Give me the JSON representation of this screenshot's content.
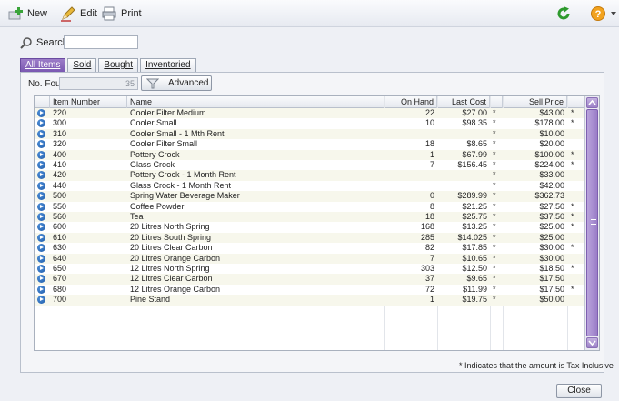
{
  "toolbar": {
    "new_label": "New",
    "edit_label": "Edit",
    "print_label": "Print",
    "icons": [
      "new-icon",
      "edit-icon",
      "print-icon",
      "refresh-icon",
      "help-icon"
    ],
    "accent_color": "#2e9a2e"
  },
  "search": {
    "label": "Search:",
    "value": ""
  },
  "tabs": [
    {
      "label": "All Items",
      "active": true
    },
    {
      "label": "Sold",
      "active": false
    },
    {
      "label": "Bought",
      "active": false
    },
    {
      "label": "Inventoried",
      "active": false
    }
  ],
  "found": {
    "label": "No. Found:",
    "value": "35"
  },
  "advanced_label": "Advanced",
  "columns": [
    "Item Number",
    "Name",
    "On Hand",
    "Last Cost",
    "",
    "Sell Price",
    ""
  ],
  "rows": [
    [
      "220",
      "Cooler Filter Medium",
      "22",
      "$27.00",
      "*",
      "$43.00",
      "*"
    ],
    [
      "300",
      "Cooler Small",
      "10",
      "$98.35",
      "*",
      "$178.00",
      "*"
    ],
    [
      "310",
      "Cooler Small - 1 Mth Rent",
      "",
      "",
      "*",
      "$10.00",
      ""
    ],
    [
      "320",
      "Cooler Filter Small",
      "18",
      "$8.65",
      "*",
      "$20.00",
      ""
    ],
    [
      "400",
      "Pottery Crock",
      "1",
      "$67.99",
      "*",
      "$100.00",
      "*"
    ],
    [
      "410",
      "Glass Crock",
      "7",
      "$156.45",
      "*",
      "$224.00",
      "*"
    ],
    [
      "420",
      "Pottery Crock - 1 Month Rent",
      "",
      "",
      "*",
      "$33.00",
      ""
    ],
    [
      "440",
      "Glass Crock - 1 Month Rent",
      "",
      "",
      "*",
      "$42.00",
      ""
    ],
    [
      "500",
      "Spring Water Beverage Maker",
      "0",
      "$289.99",
      "*",
      "$362.73",
      ""
    ],
    [
      "550",
      "Coffee Powder",
      "8",
      "$21.25",
      "*",
      "$27.50",
      "*"
    ],
    [
      "560",
      "Tea",
      "18",
      "$25.75",
      "*",
      "$37.50",
      "*"
    ],
    [
      "600",
      "20 Litres North Spring",
      "168",
      "$13.25",
      "*",
      "$25.00",
      "*"
    ],
    [
      "610",
      "20 Litres South Spring",
      "285",
      "$14.025",
      "*",
      "$25.00",
      ""
    ],
    [
      "630",
      "20 Litres Clear Carbon",
      "82",
      "$17.85",
      "*",
      "$30.00",
      "*"
    ],
    [
      "640",
      "20 Litres Orange Carbon",
      "7",
      "$10.65",
      "*",
      "$30.00",
      ""
    ],
    [
      "650",
      "12 Litres North Spring",
      "303",
      "$12.50",
      "*",
      "$18.50",
      "*"
    ],
    [
      "670",
      "12 Litres Clear Carbon",
      "37",
      "$9.65",
      "*",
      "$17.50",
      ""
    ],
    [
      "680",
      "12 Litres Orange Carbon",
      "72",
      "$11.99",
      "*",
      "$17.50",
      "*"
    ],
    [
      "700",
      "Pine Stand",
      "1",
      "$19.75",
      "*",
      "$50.00",
      ""
    ]
  ],
  "footnote": "* Indicates that the amount is Tax Inclusive",
  "close_label": "Close"
}
